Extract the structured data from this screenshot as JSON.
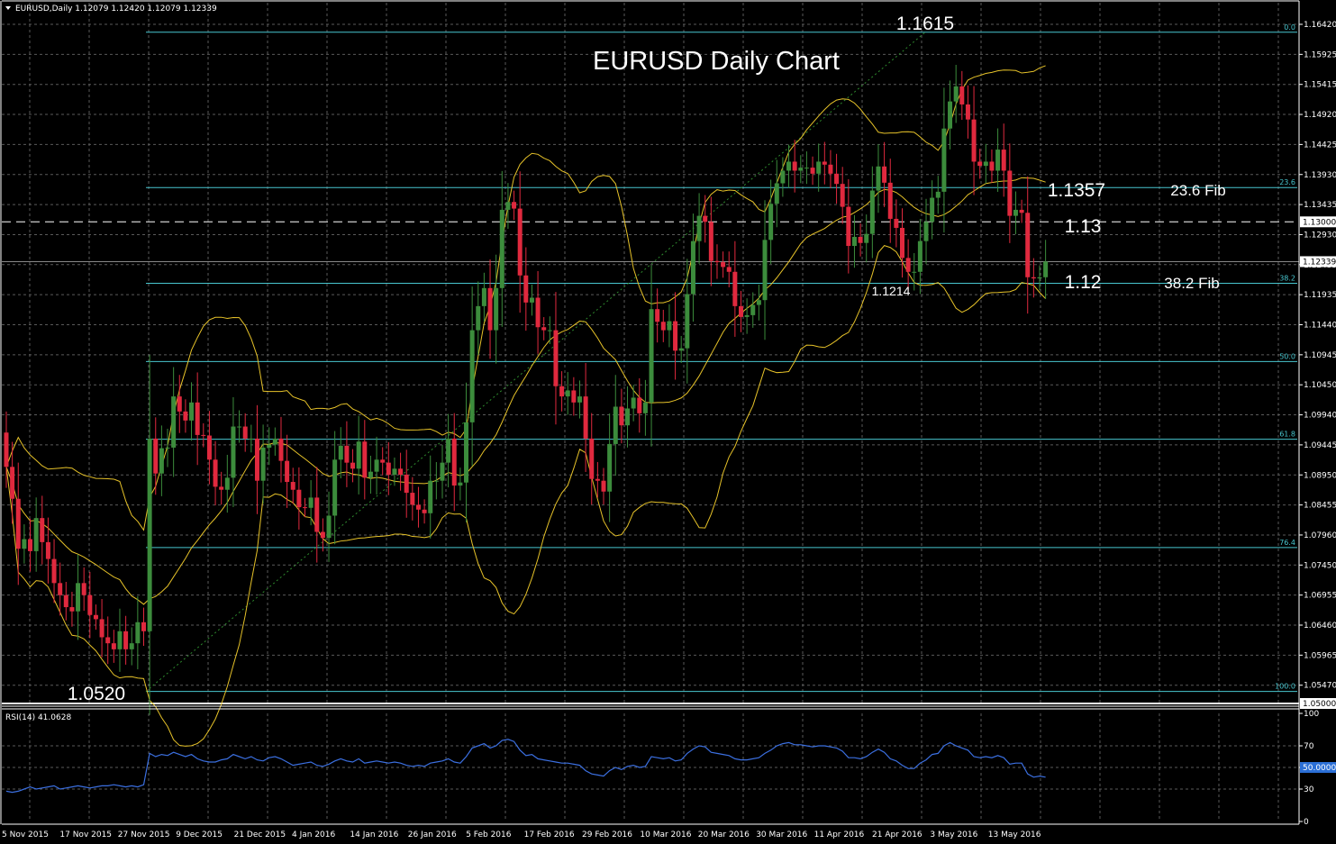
{
  "header": {
    "symbol_info": "EURUSD,Daily  1.12079 1.12420 1.12079 1.12339"
  },
  "rsi_header": "RSI(14) 41.0628",
  "chart_data": [
    {
      "type": "candlestick",
      "title": "EURUSD Daily Chart",
      "ylim": [
        1.05,
        1.1664
      ],
      "y_ticks": [
        "1.16420",
        "1.15925",
        "1.15415",
        "1.14920",
        "1.14425",
        "1.13930",
        "1.13435",
        "1.12930",
        "1.12435",
        "1.11935",
        "1.11440",
        "1.10945",
        "1.10450",
        "1.09940",
        "1.09445",
        "1.08950",
        "1.08455",
        "1.07960",
        "1.07450",
        "1.06955",
        "1.06460",
        "1.05965",
        "1.05470"
      ],
      "x_ticks": [
        "5 Nov 2015",
        "17 Nov 2015",
        "27 Nov 2015",
        "9 Dec 2015",
        "21 Dec 2015",
        "4 Jan 2016",
        "14 Jan 2016",
        "26 Jan 2016",
        "5 Feb 2016",
        "17 Feb 2016",
        "29 Feb 2016",
        "10 Mar 2016",
        "20 Mar 2016",
        "30 Mar 2016",
        "11 Apr 2016",
        "21 Apr 2016",
        "3 May 2016",
        "13 May 2016"
      ],
      "price_boxes": [
        {
          "label": "1.13000",
          "price": 1.13
        },
        {
          "label": "1.12339",
          "price": 1.12339
        },
        {
          "label": "1.05000",
          "price": 1.05
        }
      ],
      "fib_levels": [
        {
          "label": "0.0",
          "price": 1.1615
        },
        {
          "label": "23.6",
          "price": 1.1357
        },
        {
          "label": "38.2",
          "price": 1.1198
        },
        {
          "label": "50.0",
          "price": 1.1068
        },
        {
          "label": "61.8",
          "price": 1.0939
        },
        {
          "label": "76.4",
          "price": 1.0759
        },
        {
          "label": "100.0",
          "price": 1.052
        }
      ],
      "annotations": {
        "high": "1.1615",
        "low": "1.0520",
        "swing_low": "1.1214",
        "fib236_value": "1.1357",
        "fib236_text": "23.6 Fib",
        "level_113": "1.13",
        "level_112": "1.12",
        "fib382_text": "38.2 Fib"
      },
      "bollinger": {
        "periods": 20,
        "deviation": 2
      },
      "close": [
        1.0893,
        1.084,
        1.0757,
        1.0773,
        1.0753,
        1.0808,
        1.0768,
        1.074,
        1.07,
        1.068,
        1.066,
        1.0653,
        1.07,
        1.068,
        1.0647,
        1.064,
        1.061,
        1.06,
        1.059,
        1.062,
        1.059,
        1.06,
        1.0635,
        1.062,
        1.094,
        1.0882,
        1.0924,
        1.0925,
        1.101,
        1.0985,
        1.097,
        1.1,
        1.0946,
        1.0945,
        1.0905,
        1.086,
        1.0855,
        1.0875,
        1.096,
        1.096,
        1.094,
        1.094,
        1.087,
        1.0925,
        1.093,
        1.094,
        1.0903,
        1.0868,
        1.0855,
        1.0826,
        1.0825,
        1.0842,
        1.0785,
        1.0775,
        1.0812,
        1.0905,
        1.0928,
        1.09,
        1.089,
        1.0935,
        1.0875,
        1.0885,
        1.0905,
        1.09,
        1.088,
        1.089,
        1.088,
        1.085,
        1.083,
        1.0822,
        1.0816,
        1.087,
        1.087,
        1.09,
        1.094,
        1.0862,
        1.0867,
        1.0967,
        1.112,
        1.116,
        1.119,
        1.112,
        1.119,
        1.132,
        1.1333,
        1.1322,
        1.1211,
        1.1166,
        1.1174,
        1.1125,
        1.112,
        1.112,
        1.1027,
        1.101,
        1.102,
        1.1,
        1.101,
        1.094,
        1.0873,
        1.087,
        1.0852,
        1.0931,
        1.0993,
        1.0962,
        1.099,
        1.1008,
        1.0982,
        1.1,
        1.1155,
        1.1134,
        1.112,
        1.1135,
        1.1086,
        1.109,
        1.118,
        1.1268,
        1.131,
        1.13,
        1.1235,
        1.1233,
        1.1225,
        1.1217,
        1.116,
        1.1142,
        1.1145,
        1.1162,
        1.117,
        1.127,
        1.133,
        1.1364,
        1.1385,
        1.14,
        1.1385,
        1.139,
        1.139,
        1.138,
        1.14,
        1.1395,
        1.138,
        1.1363,
        1.1325,
        1.126,
        1.1275,
        1.1265,
        1.128,
        1.1352,
        1.1392,
        1.1365,
        1.1305,
        1.129,
        1.124,
        1.1217,
        1.1217,
        1.1268,
        1.13,
        1.134,
        1.135,
        1.1455,
        1.15,
        1.1525,
        1.1495,
        1.147,
        1.14,
        1.1393,
        1.14,
        1.1385,
        1.142,
        1.1385,
        1.131,
        1.132,
        1.1315,
        1.1208,
        1.1206,
        1.1208,
        1.1234
      ],
      "rsi_levels": [
        30,
        50,
        70
      ],
      "rsi_axis": [
        "100",
        "70",
        "50.0000",
        "30",
        "0"
      ],
      "rsi": [
        28,
        27,
        28,
        30,
        32,
        30,
        31,
        32,
        33,
        30,
        31,
        32,
        33,
        32,
        31,
        32,
        33,
        33,
        34,
        33,
        32,
        33,
        32,
        34,
        63,
        60,
        62,
        61,
        64,
        62,
        60,
        62,
        58,
        56,
        55,
        55,
        57,
        58,
        62,
        60,
        58,
        60,
        57,
        56,
        59,
        60,
        58,
        55,
        52,
        53,
        54,
        55,
        52,
        51,
        53,
        56,
        58,
        56,
        55,
        58,
        54,
        55,
        56,
        55,
        54,
        55,
        54,
        52,
        51,
        52,
        51,
        54,
        55,
        56,
        58,
        55,
        54,
        60,
        68,
        70,
        72,
        68,
        70,
        75,
        76,
        74,
        66,
        61,
        62,
        58,
        57,
        56,
        55,
        54,
        54,
        53,
        52,
        47,
        44,
        43,
        42,
        47,
        50,
        48,
        51,
        52,
        50,
        51,
        60,
        59,
        58,
        59,
        56,
        57,
        63,
        67,
        70,
        69,
        64,
        63,
        62,
        61,
        58,
        57,
        57,
        58,
        59,
        63,
        66,
        70,
        72,
        73,
        71,
        71,
        70,
        69,
        70,
        70,
        69,
        68,
        65,
        59,
        59,
        58,
        60,
        64,
        67,
        64,
        58,
        56,
        52,
        49,
        49,
        54,
        57,
        62,
        63,
        70,
        73,
        70,
        68,
        66,
        60,
        59,
        60,
        59,
        61,
        59,
        53,
        54,
        54,
        44,
        41,
        42,
        41
      ]
    }
  ]
}
